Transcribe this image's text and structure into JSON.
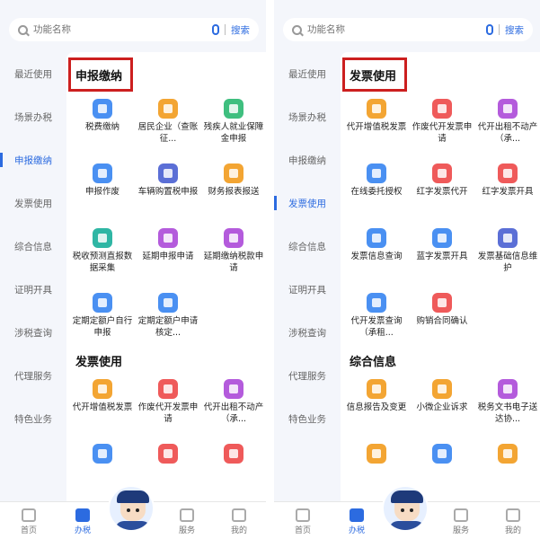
{
  "search": {
    "placeholder": "功能名称",
    "button": "搜索"
  },
  "sidebar": [
    "最近使用",
    "场景办税",
    "申报缴纳",
    "发票使用",
    "综合信息",
    "证明开具",
    "涉税查询",
    "代理服务",
    "特色业务"
  ],
  "tabbar": [
    "首页",
    "办税",
    "服务",
    "我的"
  ],
  "left": {
    "active_side": 2,
    "section1": {
      "title": "申报缴纳",
      "items": [
        {
          "label": "税费缴纳",
          "color": "#4a90f2"
        },
        {
          "label": "居民企业（查账征...",
          "color": "#f3a533"
        },
        {
          "label": "残疾人就业保障金申报",
          "color": "#3fbf7f"
        },
        {
          "label": "申报作废",
          "color": "#4a90f2"
        },
        {
          "label": "车辆购置税申报",
          "color": "#5b6fd6"
        },
        {
          "label": "财务报表报送",
          "color": "#f3a533"
        },
        {
          "label": "税收预测直报数据采集",
          "color": "#2fb6a4"
        },
        {
          "label": "延期申报申请",
          "color": "#b45bdc"
        },
        {
          "label": "延期缴纳税款申请",
          "color": "#b45bdc"
        },
        {
          "label": "定期定额户自行申报",
          "color": "#4a90f2"
        },
        {
          "label": "定期定额户申请核定...",
          "color": "#4a90f2"
        }
      ]
    },
    "section2": {
      "title": "发票使用",
      "items": [
        {
          "label": "代开增值税发票",
          "color": "#f3a533"
        },
        {
          "label": "作废代开发票申请",
          "color": "#ef5a5a"
        },
        {
          "label": "代开出租不动产（承...",
          "color": "#b45bdc"
        },
        {
          "label": "",
          "color": "#4a90f2"
        },
        {
          "label": "",
          "color": "#ef5a5a"
        },
        {
          "label": "",
          "color": "#ef5a5a"
        }
      ]
    }
  },
  "right": {
    "active_side": 3,
    "section1": {
      "title": "发票使用",
      "items": [
        {
          "label": "代开增值税发票",
          "color": "#f3a533"
        },
        {
          "label": "作废代开发票申请",
          "color": "#ef5a5a"
        },
        {
          "label": "代开出租不动产（承...",
          "color": "#b45bdc"
        },
        {
          "label": "在线委托授权",
          "color": "#4a90f2"
        },
        {
          "label": "红字发票代开",
          "color": "#ef5a5a"
        },
        {
          "label": "红字发票开具",
          "color": "#ef5a5a"
        },
        {
          "label": "发票信息查询",
          "color": "#4a90f2"
        },
        {
          "label": "蓝字发票开具",
          "color": "#4a90f2"
        },
        {
          "label": "发票基础信息维护",
          "color": "#5b6fd6"
        },
        {
          "label": "代开发票查询（承租...",
          "color": "#4a90f2"
        },
        {
          "label": "购销合同确认",
          "color": "#ef5a5a"
        }
      ]
    },
    "section2": {
      "title": "综合信息",
      "items": [
        {
          "label": "信息报告及变更",
          "color": "#f3a533"
        },
        {
          "label": "小微企业诉求",
          "color": "#f3a533"
        },
        {
          "label": "税务文书电子送达协...",
          "color": "#b45bdc"
        },
        {
          "label": "",
          "color": "#f3a533"
        },
        {
          "label": "",
          "color": "#4a90f2"
        },
        {
          "label": "",
          "color": "#f3a533"
        }
      ]
    }
  }
}
